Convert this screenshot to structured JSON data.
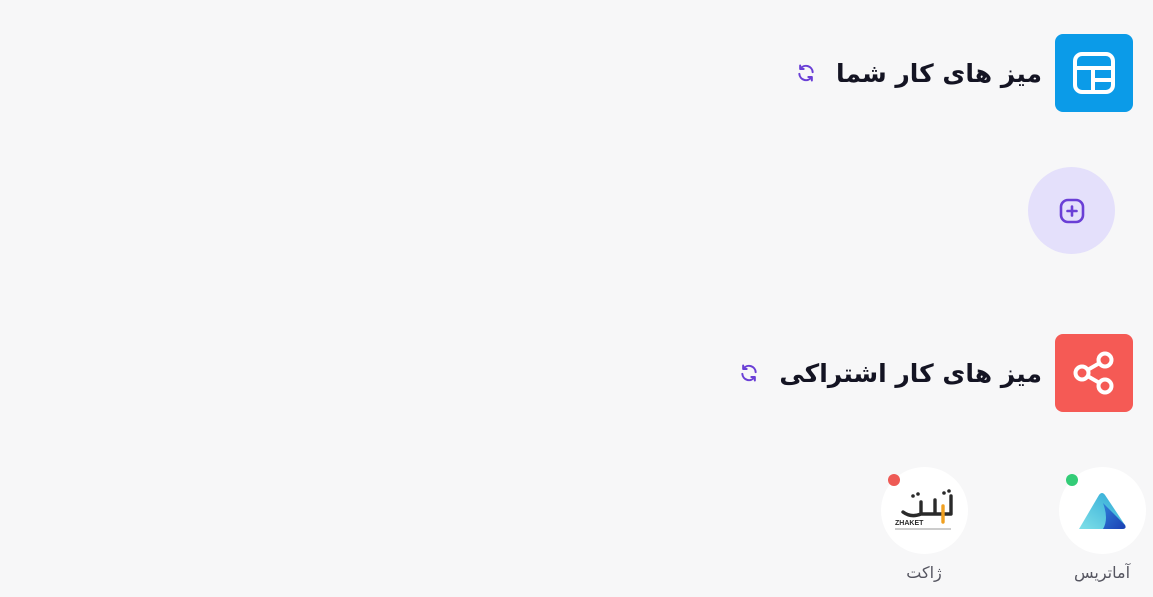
{
  "sections": {
    "yours": {
      "title": "میز های کار شما",
      "icon": "layout-grid-icon",
      "color": "#0b9be8"
    },
    "shared": {
      "title": "میز های کار اشتراکی",
      "icon": "share-icon",
      "color": "#f55a55"
    }
  },
  "add_workspace": {
    "icon": "plus-square-icon"
  },
  "workspaces": [
    {
      "name": "آماتریس",
      "status": "online",
      "status_color": "#33cc77",
      "icon": "amatris-logo"
    },
    {
      "name": "ژاکت",
      "status": "offline",
      "status_color": "#ee5a55",
      "icon": "zhaket-logo",
      "logo_text": "ZHAKET"
    }
  ],
  "accent_color": "#6a3fd6"
}
